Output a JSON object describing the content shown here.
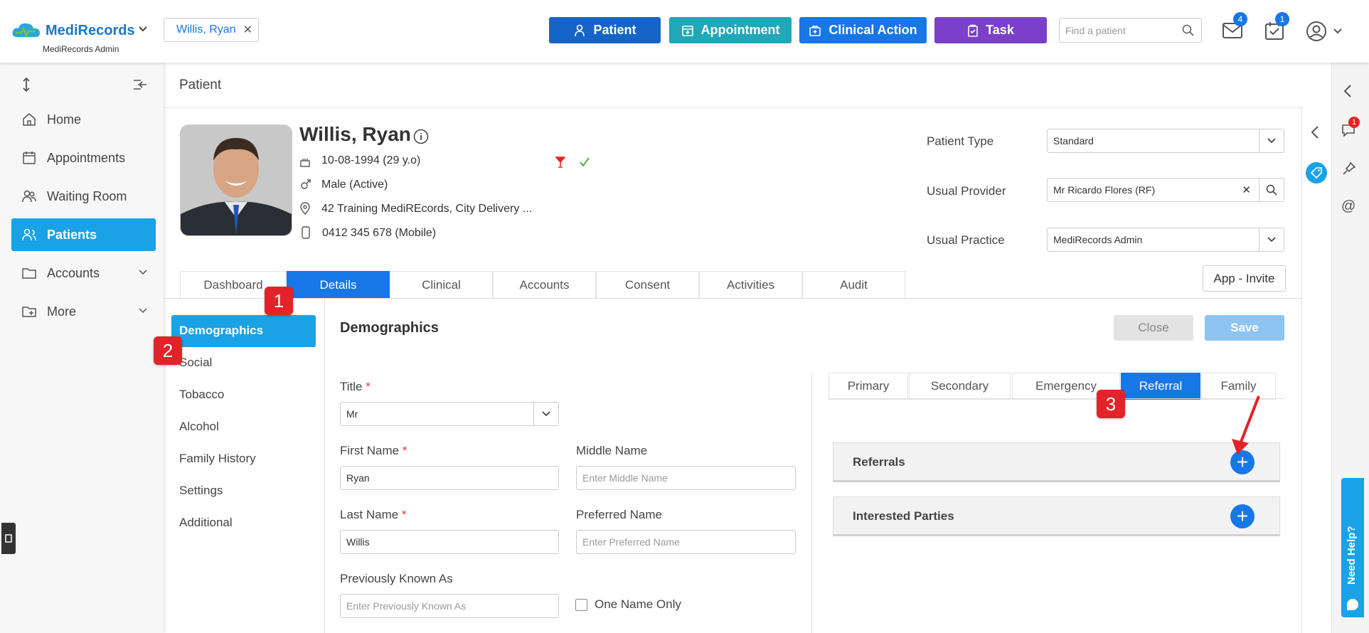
{
  "brand": {
    "name": "MediRecords",
    "sub": "MediRecords Admin"
  },
  "patient_chip": "Willis, Ryan",
  "header_buttons": {
    "patient": "Patient",
    "appointment": "Appointment",
    "clinical": "Clinical Action",
    "task": "Task"
  },
  "search": {
    "placeholder": "Find a patient"
  },
  "badges": {
    "mail": "4",
    "tasks": "1"
  },
  "nav": [
    {
      "label": "Home"
    },
    {
      "label": "Appointments"
    },
    {
      "label": "Waiting Room"
    },
    {
      "label": "Patients"
    },
    {
      "label": "Accounts"
    },
    {
      "label": "More"
    }
  ],
  "page_title": "Patient",
  "patient": {
    "name": "Willis, Ryan",
    "dob": "10-08-1994 (29 y.o)",
    "gender": "Male (Active)",
    "address": "42 Training MediREcords, City Delivery ...",
    "phone": "0412 345 678 (Mobile)"
  },
  "fields": {
    "patient_type_label": "Patient Type",
    "patient_type": "Standard",
    "usual_provider_label": "Usual Provider",
    "usual_provider": "Mr Ricardo Flores (RF)",
    "usual_practice_label": "Usual Practice",
    "usual_practice": "MediRecords Admin"
  },
  "app_invite": "App - Invite",
  "tabs": [
    "Dashboard",
    "Details",
    "Clinical",
    "Accounts",
    "Consent",
    "Activities",
    "Audit"
  ],
  "subnav": [
    "Demographics",
    "Social",
    "Tobacco",
    "Alcohol",
    "Family History",
    "Settings",
    "Additional"
  ],
  "section_title": "Demographics",
  "actions": {
    "close": "Close",
    "save": "Save"
  },
  "form": {
    "title_label": "Title",
    "title_value": "Mr",
    "first_name_label": "First Name",
    "first_name": "Ryan",
    "middle_name_label": "Middle Name",
    "middle_name_ph": "Enter Middle Name",
    "last_name_label": "Last Name",
    "last_name": "Willis",
    "preferred_name_label": "Preferred Name",
    "preferred_name_ph": "Enter Preferred Name",
    "pka_label": "Previously Known As",
    "pka_ph": "Enter Previously Known As",
    "one_name_only": "One Name Only"
  },
  "contact_tabs": [
    "Primary",
    "Secondary",
    "Emergency",
    "Referral",
    "Family"
  ],
  "panels": {
    "referrals": "Referrals",
    "interested": "Interested Parties"
  },
  "markers": [
    "1",
    "2",
    "3"
  ],
  "help": "Need Help?",
  "right_badge": "1",
  "colors": {
    "primary": "#1777e6",
    "teal": "#1aa2e6",
    "appointment": "#21a7b7",
    "task": "#7b3fc9",
    "marker": "#e2232a"
  }
}
